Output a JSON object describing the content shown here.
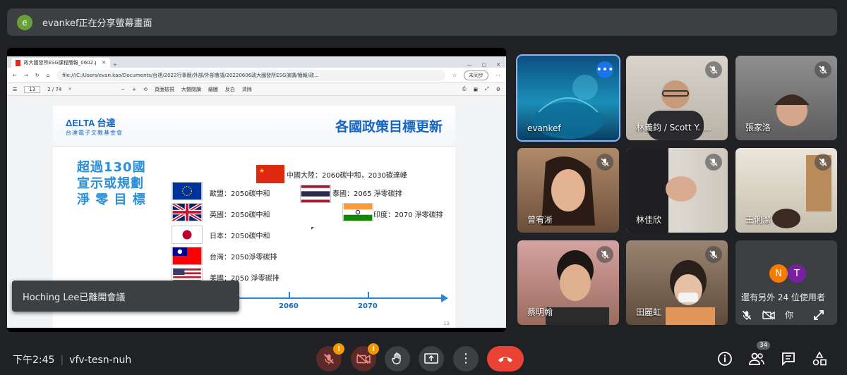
{
  "banner": {
    "avatar_letter": "e",
    "text": "evankef正在分享螢幕畫面",
    "avatar_color": "#689f38"
  },
  "browser": {
    "tab_title": "政大國發所ESG課程簡報_0602.p...",
    "url": "file:///C:/Users/evan.kao/Documents/台達/2022行事曆/外部/外部會議/20220606政大國發所ESG演講/簡報/政...",
    "sync_label": "未同步",
    "page_current": "13",
    "page_total": "2 / 74",
    "toolbar": [
      "頁面檢視",
      "大聲閱讀",
      "繪圖",
      "反白",
      "清除"
    ]
  },
  "slide": {
    "logo": "ΔELTA 台達",
    "logo_sub": "台達電子文教基金會",
    "title": "各國政策目標更新",
    "headline": [
      "超過130國",
      "宣示或規劃",
      "淨 零 目 標"
    ],
    "countries": [
      {
        "label": "中國大陸：2060碳中和，2030碳達峰",
        "flag": "china-flag-icon"
      },
      {
        "label": "歐盟：2050碳中和",
        "flag": "eu-flag-icon"
      },
      {
        "label": "泰國：2065 淨零碳排",
        "flag": "thailand-flag-icon"
      },
      {
        "label": "英國：2050碳中和",
        "flag": "uk-flag-icon"
      },
      {
        "label": "印度：2070 淨零碳排",
        "flag": "india-flag-icon"
      },
      {
        "label": "日本：2050碳中和",
        "flag": "japan-flag-icon"
      },
      {
        "label": "台灣：2050淨零碳排",
        "flag": "taiwan-flag-icon"
      },
      {
        "label": "美國：2050 淨零碳排",
        "flag": "usa-flag-icon"
      }
    ],
    "timeline_years": [
      "2060",
      "2070"
    ],
    "page_number": "13"
  },
  "toast": {
    "text": "Hoching Lee已離開會議"
  },
  "participants": [
    {
      "name": "evankef",
      "muted": false
    },
    {
      "name": "林義鈞 / Scott Y. ...",
      "muted": true
    },
    {
      "name": "張家洛",
      "muted": true
    },
    {
      "name": "曾宥淅",
      "muted": true
    },
    {
      "name": "林佳欣",
      "muted": true
    },
    {
      "name": "王俐潔",
      "muted": true
    },
    {
      "name": "蔡明翰",
      "muted": true
    },
    {
      "name": "田麗虹",
      "muted": true
    }
  ],
  "others": {
    "text": "還有另外 24 位使用者",
    "bubbles": [
      {
        "letter": "N",
        "color": "#f57c00"
      },
      {
        "letter": "T",
        "color": "#7b1fa2"
      }
    ],
    "you_label": "你"
  },
  "bottom": {
    "time": "下午2:45",
    "meeting_code": "vfv-tesn-nuh",
    "participant_count": "34",
    "warn_symbol": "!"
  }
}
